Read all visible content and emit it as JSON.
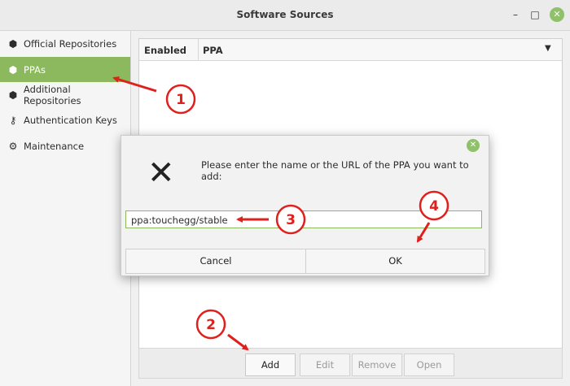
{
  "window": {
    "title": "Software Sources",
    "minimize_icon": "–",
    "maximize_icon": "□",
    "close_icon": "✕"
  },
  "sidebar": {
    "items": [
      {
        "label": "Official Repositories",
        "icon": "package-icon"
      },
      {
        "label": "PPAs",
        "icon": "package-icon"
      },
      {
        "label": "Additional Repositories",
        "icon": "package-icon"
      },
      {
        "label": "Authentication Keys",
        "icon": "key-icon"
      },
      {
        "label": "Maintenance",
        "icon": "gear-icon"
      }
    ]
  },
  "table": {
    "col_enabled": "Enabled",
    "col_ppa": "PPA"
  },
  "buttons": {
    "add": "Add",
    "edit": "Edit",
    "remove": "Remove",
    "open": "Open"
  },
  "dialog": {
    "message": "Please enter the name or the URL of the PPA you want to add:",
    "input_value": "ppa:touchegg/stable",
    "cancel": "Cancel",
    "ok": "OK",
    "icon": "✕"
  },
  "annotations": {
    "n1": "1",
    "n2": "2",
    "n3": "3",
    "n4": "4",
    "color": "#e0201c"
  }
}
